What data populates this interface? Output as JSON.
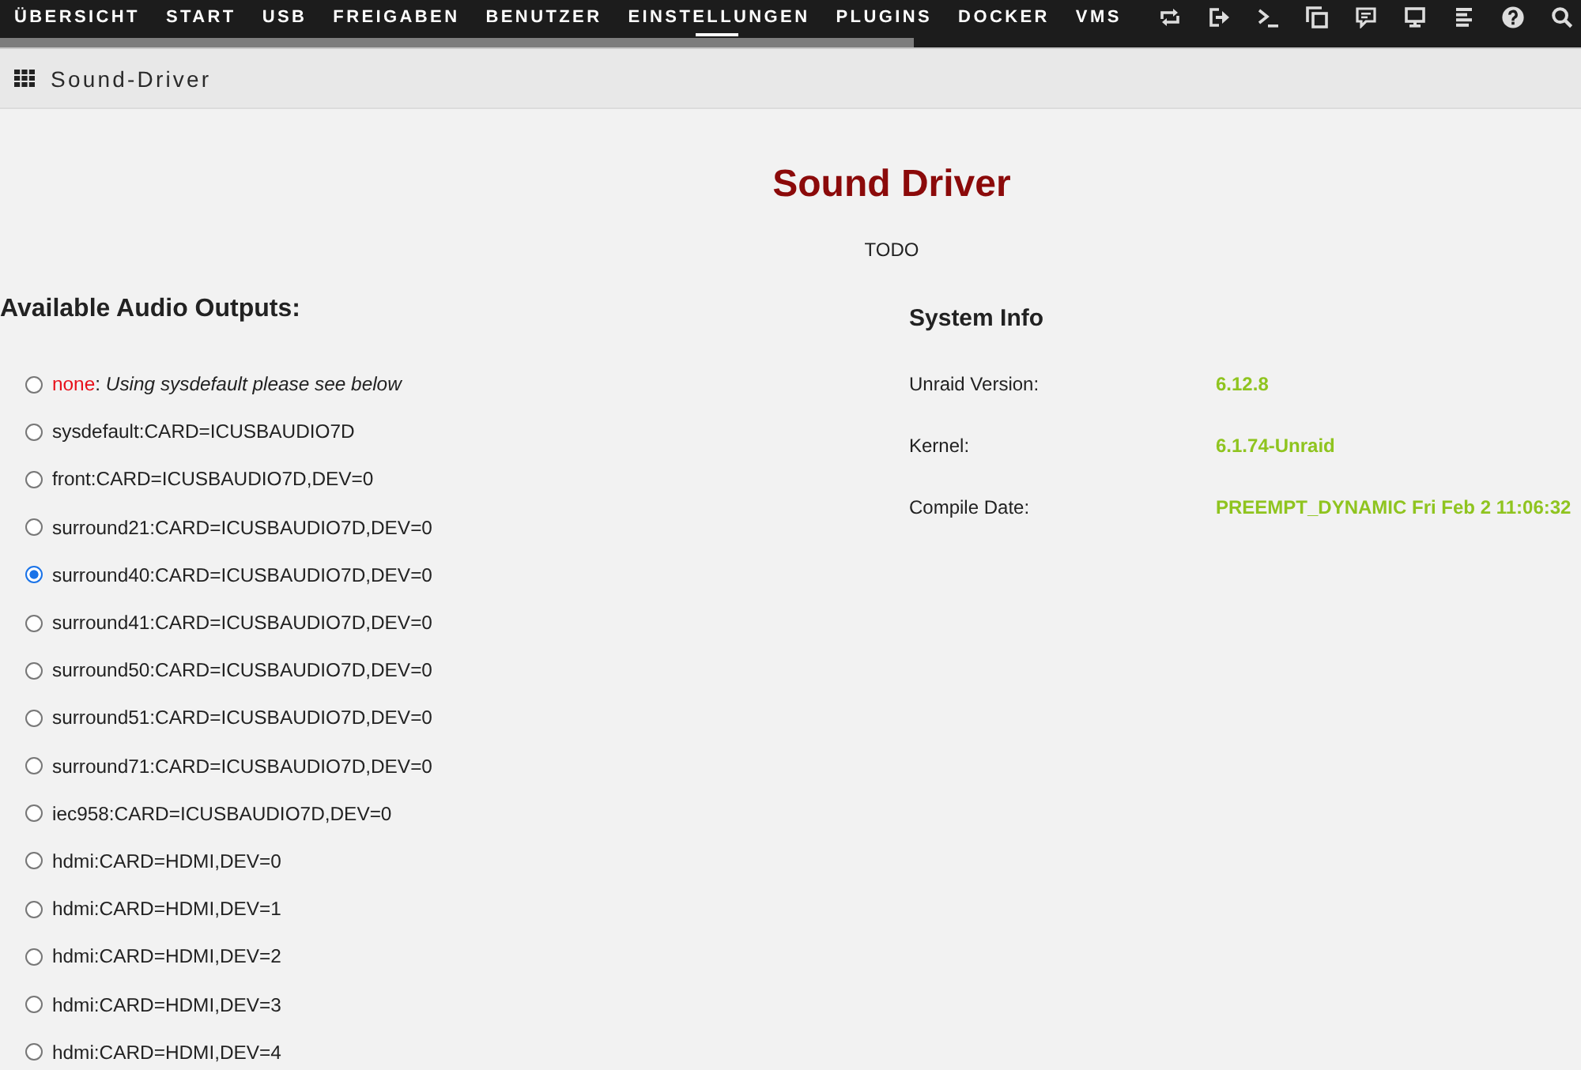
{
  "top_nav": {
    "tabs": [
      {
        "label": "ÜBERSICHT",
        "selected": false
      },
      {
        "label": "START",
        "selected": false
      },
      {
        "label": "USB",
        "selected": false
      },
      {
        "label": "FREIGABEN",
        "selected": false
      },
      {
        "label": "BENUTZER",
        "selected": false
      },
      {
        "label": "EINSTELLUNGEN",
        "selected": true
      },
      {
        "label": "PLUGINS",
        "selected": false
      },
      {
        "label": "DOCKER",
        "selected": false
      },
      {
        "label": "VMS",
        "selected": false
      }
    ]
  },
  "page_header": {
    "title": "Sound-Driver"
  },
  "heading": "Sound Driver",
  "subtitle": "TODO",
  "audio_outputs": {
    "title": "Available Audio Outputs:",
    "options": [
      {
        "kind": "default",
        "label": "none",
        "note": ": *Using sysdefault please see below*",
        "selected": false
      },
      {
        "kind": "device",
        "label": "sysdefault:CARD=ICUSBAUDIO7D",
        "selected": false
      },
      {
        "kind": "device",
        "label": "front:CARD=ICUSBAUDIO7D,DEV=0",
        "selected": false
      },
      {
        "kind": "device",
        "label": "surround21:CARD=ICUSBAUDIO7D,DEV=0",
        "selected": false
      },
      {
        "kind": "device",
        "label": "surround40:CARD=ICUSBAUDIO7D,DEV=0",
        "selected": true
      },
      {
        "kind": "device",
        "label": "surround41:CARD=ICUSBAUDIO7D,DEV=0",
        "selected": false
      },
      {
        "kind": "device",
        "label": "surround50:CARD=ICUSBAUDIO7D,DEV=0",
        "selected": false
      },
      {
        "kind": "device",
        "label": "surround51:CARD=ICUSBAUDIO7D,DEV=0",
        "selected": false
      },
      {
        "kind": "device",
        "label": "surround71:CARD=ICUSBAUDIO7D,DEV=0",
        "selected": false
      },
      {
        "kind": "device",
        "label": "iec958:CARD=ICUSBAUDIO7D,DEV=0",
        "selected": false
      },
      {
        "kind": "device",
        "label": "hdmi:CARD=HDMI,DEV=0",
        "selected": false
      },
      {
        "kind": "device",
        "label": "hdmi:CARD=HDMI,DEV=1",
        "selected": false
      },
      {
        "kind": "device",
        "label": "hdmi:CARD=HDMI,DEV=2",
        "selected": false
      },
      {
        "kind": "device",
        "label": "hdmi:CARD=HDMI,DEV=3",
        "selected": false
      },
      {
        "kind": "device",
        "label": "hdmi:CARD=HDMI,DEV=4",
        "selected": false
      }
    ]
  },
  "system_info": {
    "title": "System Info",
    "rows": [
      {
        "label": "Unraid Version:",
        "value": "6.12.8"
      },
      {
        "label": "Kernel:",
        "value": "6.1.74-Unraid"
      },
      {
        "label": "Compile Date:",
        "value": "PREEMPT_DYNAMIC Fri Feb 2 11:06:32"
      }
    ]
  }
}
